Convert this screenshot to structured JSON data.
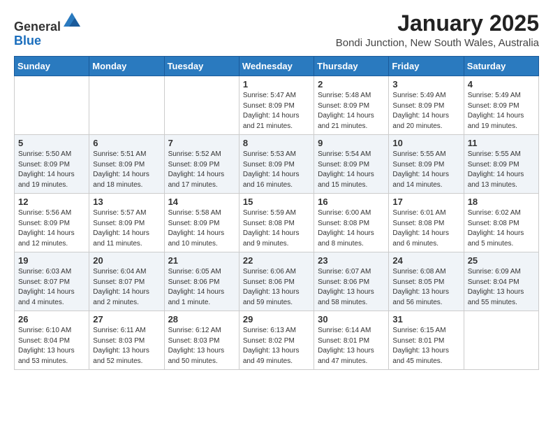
{
  "header": {
    "logo_general": "General",
    "logo_blue": "Blue",
    "month_title": "January 2025",
    "subtitle": "Bondi Junction, New South Wales, Australia"
  },
  "days_of_week": [
    "Sunday",
    "Monday",
    "Tuesday",
    "Wednesday",
    "Thursday",
    "Friday",
    "Saturday"
  ],
  "weeks": [
    [
      {
        "day": "",
        "info": ""
      },
      {
        "day": "",
        "info": ""
      },
      {
        "day": "",
        "info": ""
      },
      {
        "day": "1",
        "info": "Sunrise: 5:47 AM\nSunset: 8:09 PM\nDaylight: 14 hours\nand 21 minutes."
      },
      {
        "day": "2",
        "info": "Sunrise: 5:48 AM\nSunset: 8:09 PM\nDaylight: 14 hours\nand 21 minutes."
      },
      {
        "day": "3",
        "info": "Sunrise: 5:49 AM\nSunset: 8:09 PM\nDaylight: 14 hours\nand 20 minutes."
      },
      {
        "day": "4",
        "info": "Sunrise: 5:49 AM\nSunset: 8:09 PM\nDaylight: 14 hours\nand 19 minutes."
      }
    ],
    [
      {
        "day": "5",
        "info": "Sunrise: 5:50 AM\nSunset: 8:09 PM\nDaylight: 14 hours\nand 19 minutes."
      },
      {
        "day": "6",
        "info": "Sunrise: 5:51 AM\nSunset: 8:09 PM\nDaylight: 14 hours\nand 18 minutes."
      },
      {
        "day": "7",
        "info": "Sunrise: 5:52 AM\nSunset: 8:09 PM\nDaylight: 14 hours\nand 17 minutes."
      },
      {
        "day": "8",
        "info": "Sunrise: 5:53 AM\nSunset: 8:09 PM\nDaylight: 14 hours\nand 16 minutes."
      },
      {
        "day": "9",
        "info": "Sunrise: 5:54 AM\nSunset: 8:09 PM\nDaylight: 14 hours\nand 15 minutes."
      },
      {
        "day": "10",
        "info": "Sunrise: 5:55 AM\nSunset: 8:09 PM\nDaylight: 14 hours\nand 14 minutes."
      },
      {
        "day": "11",
        "info": "Sunrise: 5:55 AM\nSunset: 8:09 PM\nDaylight: 14 hours\nand 13 minutes."
      }
    ],
    [
      {
        "day": "12",
        "info": "Sunrise: 5:56 AM\nSunset: 8:09 PM\nDaylight: 14 hours\nand 12 minutes."
      },
      {
        "day": "13",
        "info": "Sunrise: 5:57 AM\nSunset: 8:09 PM\nDaylight: 14 hours\nand 11 minutes."
      },
      {
        "day": "14",
        "info": "Sunrise: 5:58 AM\nSunset: 8:09 PM\nDaylight: 14 hours\nand 10 minutes."
      },
      {
        "day": "15",
        "info": "Sunrise: 5:59 AM\nSunset: 8:08 PM\nDaylight: 14 hours\nand 9 minutes."
      },
      {
        "day": "16",
        "info": "Sunrise: 6:00 AM\nSunset: 8:08 PM\nDaylight: 14 hours\nand 8 minutes."
      },
      {
        "day": "17",
        "info": "Sunrise: 6:01 AM\nSunset: 8:08 PM\nDaylight: 14 hours\nand 6 minutes."
      },
      {
        "day": "18",
        "info": "Sunrise: 6:02 AM\nSunset: 8:08 PM\nDaylight: 14 hours\nand 5 minutes."
      }
    ],
    [
      {
        "day": "19",
        "info": "Sunrise: 6:03 AM\nSunset: 8:07 PM\nDaylight: 14 hours\nand 4 minutes."
      },
      {
        "day": "20",
        "info": "Sunrise: 6:04 AM\nSunset: 8:07 PM\nDaylight: 14 hours\nand 2 minutes."
      },
      {
        "day": "21",
        "info": "Sunrise: 6:05 AM\nSunset: 8:06 PM\nDaylight: 14 hours\nand 1 minute."
      },
      {
        "day": "22",
        "info": "Sunrise: 6:06 AM\nSunset: 8:06 PM\nDaylight: 13 hours\nand 59 minutes."
      },
      {
        "day": "23",
        "info": "Sunrise: 6:07 AM\nSunset: 8:06 PM\nDaylight: 13 hours\nand 58 minutes."
      },
      {
        "day": "24",
        "info": "Sunrise: 6:08 AM\nSunset: 8:05 PM\nDaylight: 13 hours\nand 56 minutes."
      },
      {
        "day": "25",
        "info": "Sunrise: 6:09 AM\nSunset: 8:04 PM\nDaylight: 13 hours\nand 55 minutes."
      }
    ],
    [
      {
        "day": "26",
        "info": "Sunrise: 6:10 AM\nSunset: 8:04 PM\nDaylight: 13 hours\nand 53 minutes."
      },
      {
        "day": "27",
        "info": "Sunrise: 6:11 AM\nSunset: 8:03 PM\nDaylight: 13 hours\nand 52 minutes."
      },
      {
        "day": "28",
        "info": "Sunrise: 6:12 AM\nSunset: 8:03 PM\nDaylight: 13 hours\nand 50 minutes."
      },
      {
        "day": "29",
        "info": "Sunrise: 6:13 AM\nSunset: 8:02 PM\nDaylight: 13 hours\nand 49 minutes."
      },
      {
        "day": "30",
        "info": "Sunrise: 6:14 AM\nSunset: 8:01 PM\nDaylight: 13 hours\nand 47 minutes."
      },
      {
        "day": "31",
        "info": "Sunrise: 6:15 AM\nSunset: 8:01 PM\nDaylight: 13 hours\nand 45 minutes."
      },
      {
        "day": "",
        "info": ""
      }
    ]
  ]
}
